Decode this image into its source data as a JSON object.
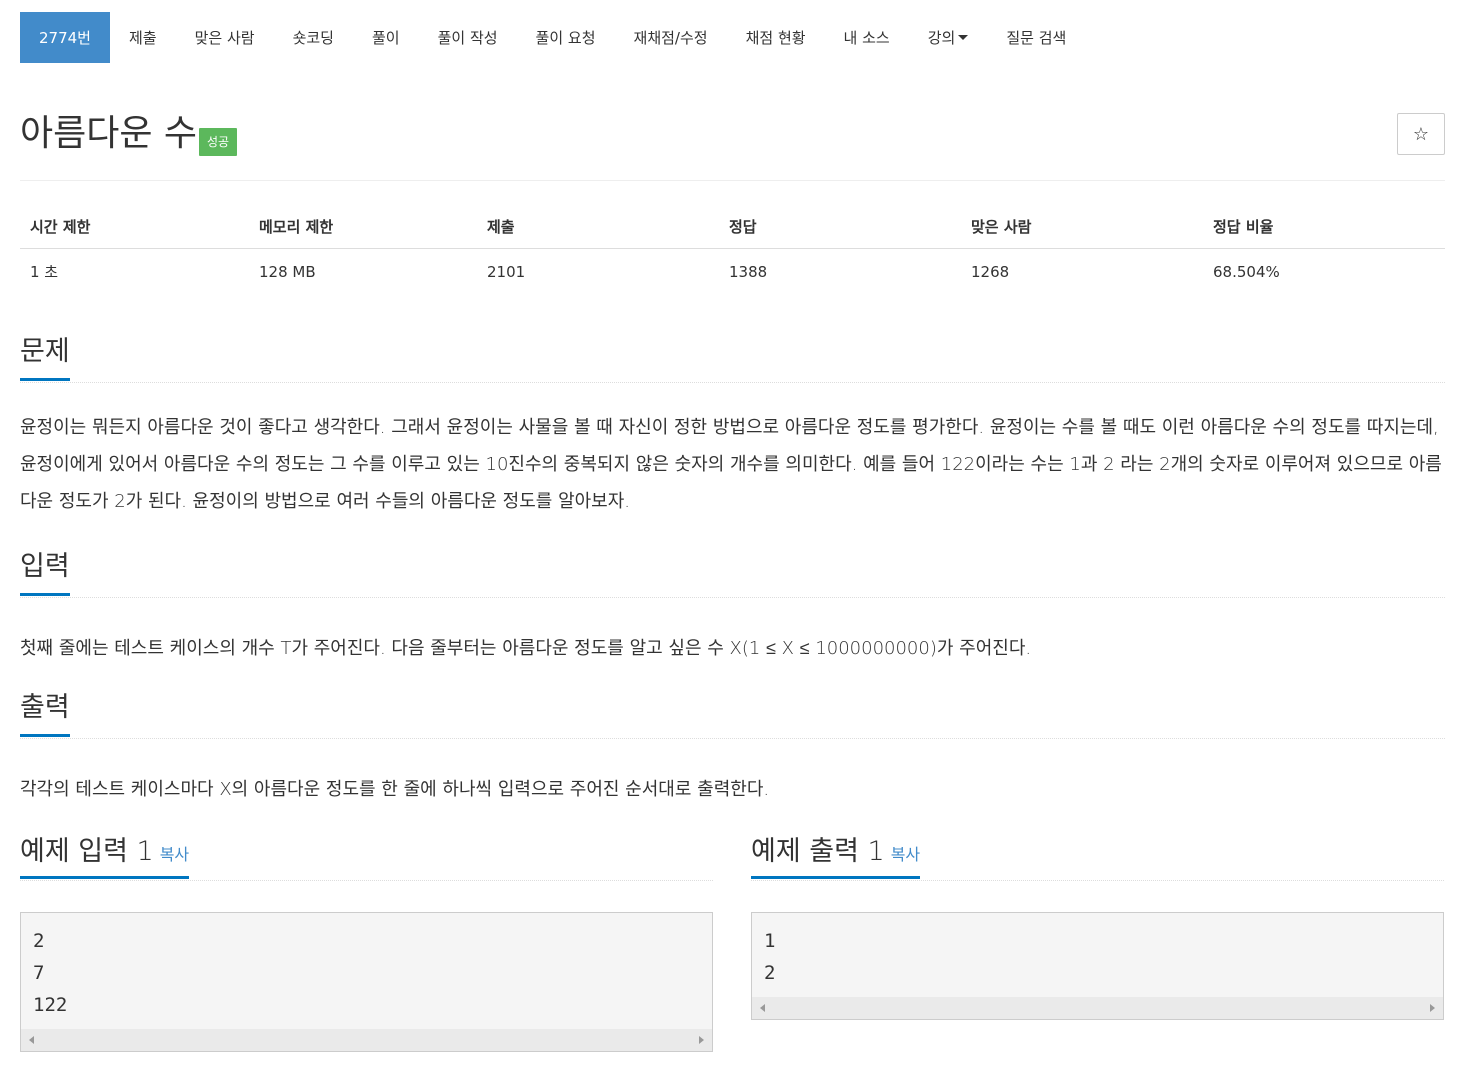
{
  "nav": {
    "tabs": [
      {
        "label": "2774번",
        "active": true
      },
      {
        "label": "제출"
      },
      {
        "label": "맞은 사람"
      },
      {
        "label": "숏코딩"
      },
      {
        "label": "풀이"
      },
      {
        "label": "풀이 작성"
      },
      {
        "label": "풀이 요청"
      },
      {
        "label": "재채점/수정"
      },
      {
        "label": "채점 현황"
      },
      {
        "label": "내 소스"
      },
      {
        "label": "강의",
        "dropdown": true
      },
      {
        "label": "질문 검색"
      }
    ]
  },
  "problem": {
    "title": "아름다운 수",
    "badge": "성공",
    "badge_color": "#5cb85c",
    "star_icon": "☆"
  },
  "info": {
    "headers": [
      "시간 제한",
      "메모리 제한",
      "제출",
      "정답",
      "맞은 사람",
      "정답 비율"
    ],
    "values": [
      "1 초",
      "128 MB",
      "2101",
      "1388",
      "1268",
      "68.504%"
    ]
  },
  "sections": {
    "description": {
      "heading": "문제",
      "text": "윤정이는 뭐든지 아름다운 것이 좋다고 생각한다. 그래서 윤정이는 사물을 볼 때 자신이 정한 방법으로 아름다운 정도를 평가한다. 윤정이는 수를 볼 때도 이런 아름다운 수의 정도를 따지는데, 윤정이에게 있어서 아름다운 수의 정도는 그 수를 이루고 있는 10진수의 중복되지 않은 숫자의 개수를 의미한다.  예를 들어 122이라는 수는 1과 2 라는 2개의 숫자로 이루어져 있으므로 아름다운 정도가 2가 된다. 윤정이의 방법으로 여러 수들의 아름다운 정도를 알아보자."
    },
    "input": {
      "heading": "입력",
      "text": "첫째 줄에는 테스트 케이스의 개수 T가 주어진다. 다음 줄부터는 아름다운 정도를 알고 싶은 수 X(1 ≤ X ≤ 1000000000)가 주어진다."
    },
    "output": {
      "heading": "출력",
      "text": "각각의 테스트 케이스마다 X의 아름다운 정도를 한 줄에 하나씩 입력으로 주어진 순서대로 출력한다."
    }
  },
  "samples": {
    "input": {
      "heading": "예제 입력 1",
      "copy": "복사",
      "lines": [
        "2",
        "7",
        "122"
      ]
    },
    "output": {
      "heading": "예제 출력 1",
      "copy": "복사",
      "lines": [
        "1",
        "2"
      ]
    }
  }
}
